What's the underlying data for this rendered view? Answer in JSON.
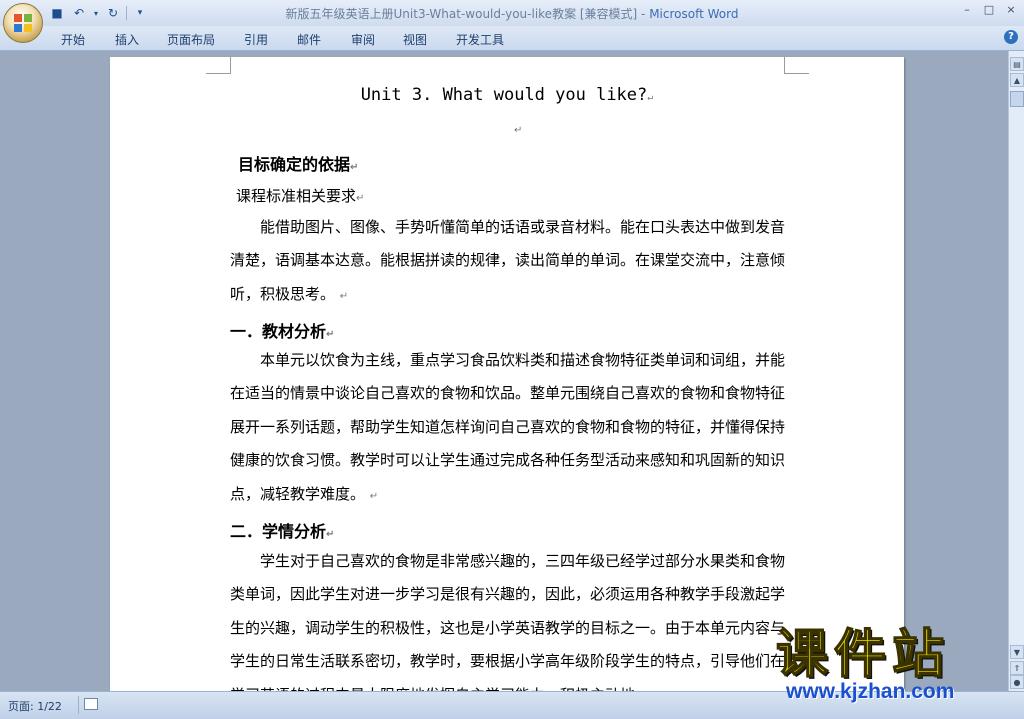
{
  "window": {
    "title": "新版五年级英语上册Unit3-What-would-you-like教案 [兼容模式] - ",
    "app_name": "Microsoft Word",
    "controls": [
      "–",
      "□",
      "×"
    ]
  },
  "quick_access": {
    "icons": [
      "save-icon",
      "undo-icon",
      "redo-icon",
      "customize-icon"
    ],
    "symbols": [
      "💾",
      "↶",
      "↻",
      "▾"
    ]
  },
  "ribbon": {
    "tabs": [
      "开始",
      "插入",
      "页面布局",
      "引用",
      "邮件",
      "审阅",
      "视图",
      "开发工具"
    ],
    "help_symbol": "?"
  },
  "document": {
    "title": "Unit 3.  What would you like?",
    "paragraph_mark": "↵",
    "section0_heading": "目标确定的依据",
    "section0_sub": "课程标准相关要求",
    "section0_body": "能借助图片、图像、手势听懂简单的话语或录音材料。能在口头表达中做到发音清楚，语调基本达意。能根据拼读的规律，读出简单的单词。在课堂交流中，注意倾听，积极思考。",
    "section1_heading": "一．教材分析",
    "section1_body": "本单元以饮食为主线，重点学习食品饮料类和描述食物特征类单词和词组，并能在适当的情景中谈论自己喜欢的食物和饮品。整单元围绕自己喜欢的食物和食物特征展开一系列话题，帮助学生知道怎样询问自己喜欢的食物和食物的特征，并懂得保持健康的饮食习惯。教学时可以让学生通过完成各种任务型活动来感知和巩固新的知识点，减轻教学难度。",
    "section2_heading": "二．学情分析",
    "section2_body": "学生对于自己喜欢的食物是非常感兴趣的，三四年级已经学过部分水果类和食物类单词，因此学生对进一步学习是很有兴趣的，因此，必须运用各种教学手段激起学生的兴趣，调动学生的积极性，这也是小学英语教学的目标之一。由于本单元内容与学生的日常生活联系密切，教学时，要根据小学高年级阶段学生的特点，引导他们在学习英语的过程中最大限度地发挥自主学习能力，积极主动地"
  },
  "statusbar": {
    "page_info": "页面: 1/22"
  },
  "watermark": {
    "big_text": "课件站",
    "url": "www.kjzhan.com"
  }
}
